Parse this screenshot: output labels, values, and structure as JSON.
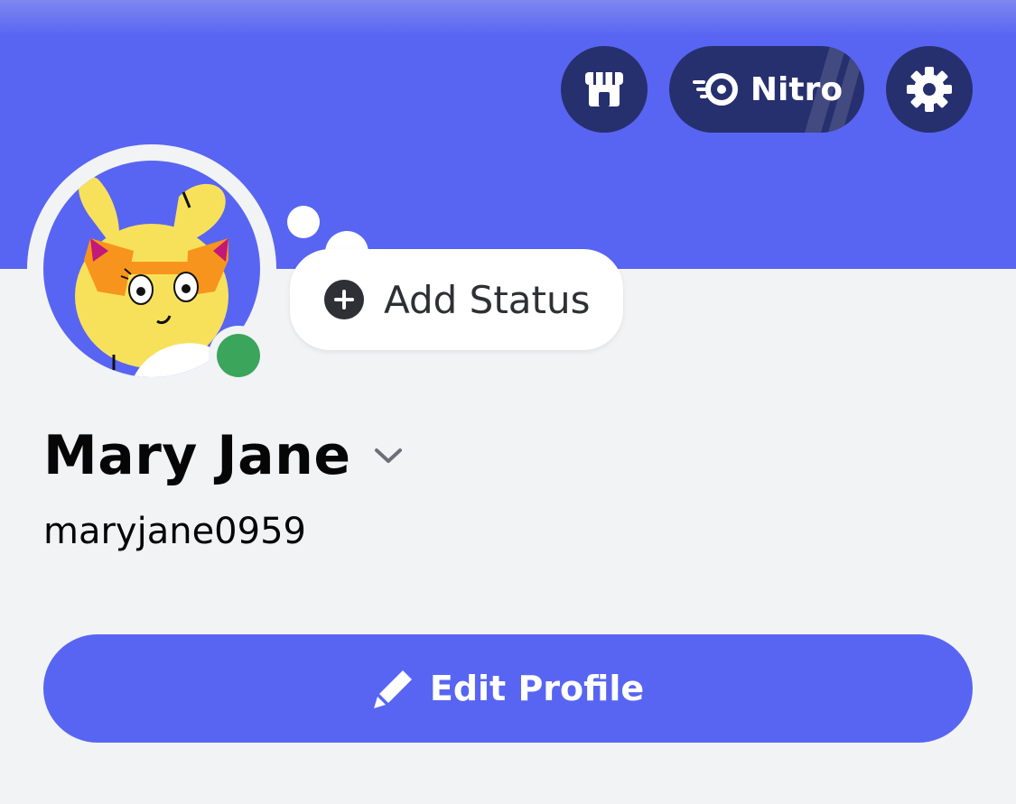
{
  "colors": {
    "blurple": "#5865f2",
    "dark_navy": "#27306e",
    "background": "#f2f3f5",
    "online_green": "#3ba55c",
    "bubble_white": "#ffffff"
  },
  "header": {
    "shop_icon": "shop-icon",
    "nitro_label": "Nitro",
    "nitro_icon": "nitro-icon",
    "settings_icon": "gear-icon"
  },
  "profile": {
    "avatar_icon": "bunny-avatar",
    "presence": "online",
    "status_prompt": "Add Status",
    "status_icon": "plus-circle-icon",
    "display_name": "Mary Jane",
    "username": "maryjane0959",
    "switch_icon": "chevron-down-icon"
  },
  "actions": {
    "edit_profile_label": "Edit Profile",
    "edit_icon": "pencil-icon"
  }
}
